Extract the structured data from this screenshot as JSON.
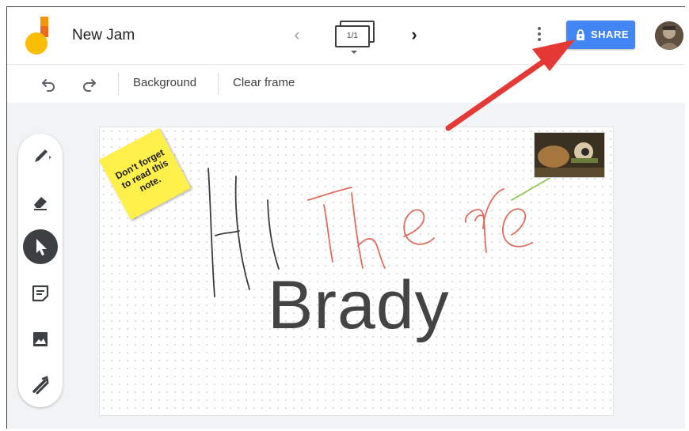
{
  "header": {
    "title": "New Jam",
    "frame_indicator": "1/1",
    "share_label": "SHARE",
    "icons": {
      "logo": "jamboard-logo",
      "prev": "chevron-left-icon",
      "next": "chevron-right-icon",
      "frames": "frame-bar-icon",
      "more": "more-vert-icon",
      "lock": "lock-icon",
      "avatar": "user-avatar"
    }
  },
  "toolbar": {
    "background_label": "Background",
    "clear_label": "Clear frame",
    "icons": [
      "undo-icon",
      "redo-icon"
    ]
  },
  "tools": [
    {
      "name": "pen",
      "icon": "pen-icon",
      "active": false
    },
    {
      "name": "eraser",
      "icon": "eraser-icon",
      "active": false
    },
    {
      "name": "select",
      "icon": "select-arrow-icon",
      "active": true
    },
    {
      "name": "sticky-note",
      "icon": "sticky-note-icon",
      "active": false
    },
    {
      "name": "image",
      "icon": "image-icon",
      "active": false
    },
    {
      "name": "laser",
      "icon": "laser-icon",
      "active": false
    }
  ],
  "canvas": {
    "sticky_note": "Don't forget to read this note.",
    "text_box": "Brady"
  },
  "colors": {
    "share_blue": "#4285f4",
    "sticky_yellow": "#fff04c",
    "active_tool": "#3c4043",
    "ink_red": "#e06c5c",
    "ink_green": "#8bc34a",
    "annotation_arrow": "#e53935"
  }
}
